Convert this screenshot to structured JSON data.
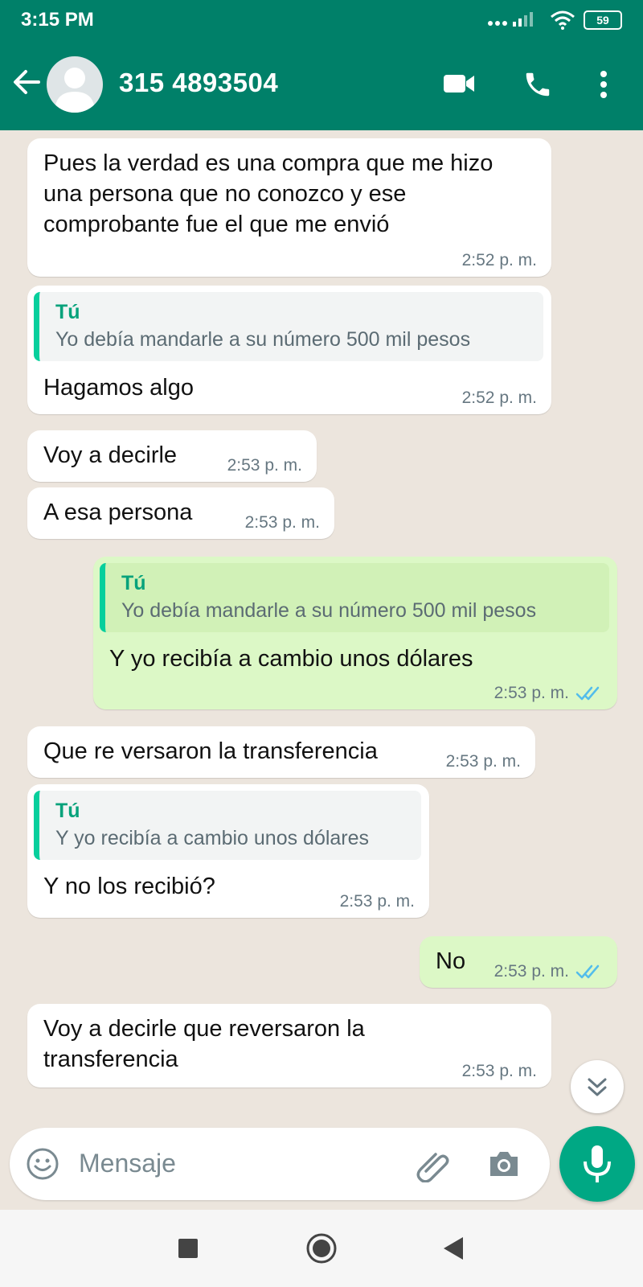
{
  "status_bar": {
    "time": "3:15 PM",
    "battery": "59"
  },
  "header": {
    "contact": "315 4893504"
  },
  "messages": [
    {
      "text": "Pues la verdad es una compra que me hizo una persona que no conozco y ese comprobante fue el que me envió",
      "time": "2:52 p. m."
    },
    {
      "quote_author": "Tú",
      "quote_text": "Yo debía mandarle a su número 500 mil pesos",
      "text": "Hagamos algo",
      "time": "2:52 p. m."
    },
    {
      "text": "Voy a decirle",
      "time": "2:53 p. m."
    },
    {
      "text": "A esa persona",
      "time": "2:53 p. m."
    },
    {
      "quote_author": "Tú",
      "quote_text": "Yo debía mandarle a su número 500 mil pesos",
      "text": "Y yo recibía a cambio unos dólares",
      "time": "2:53 p. m."
    },
    {
      "text": "Que re versaron la transferencia",
      "time": "2:53 p. m."
    },
    {
      "quote_author": "Tú",
      "quote_text": "Y yo recibía a cambio unos dólares",
      "text": "Y no los recibió?",
      "time": "2:53 p. m."
    },
    {
      "text": "No",
      "time": "2:53 p. m."
    },
    {
      "text": "Voy a decirle que reversaron la transferencia",
      "time": "2:53 p. m."
    }
  ],
  "composer": {
    "placeholder": "Mensaje"
  },
  "colors": {
    "brand": "#008069",
    "outgoing": "#dcf8c6",
    "incoming": "#ffffff",
    "read_ticks": "#53bdeb",
    "accent": "#00a884"
  }
}
